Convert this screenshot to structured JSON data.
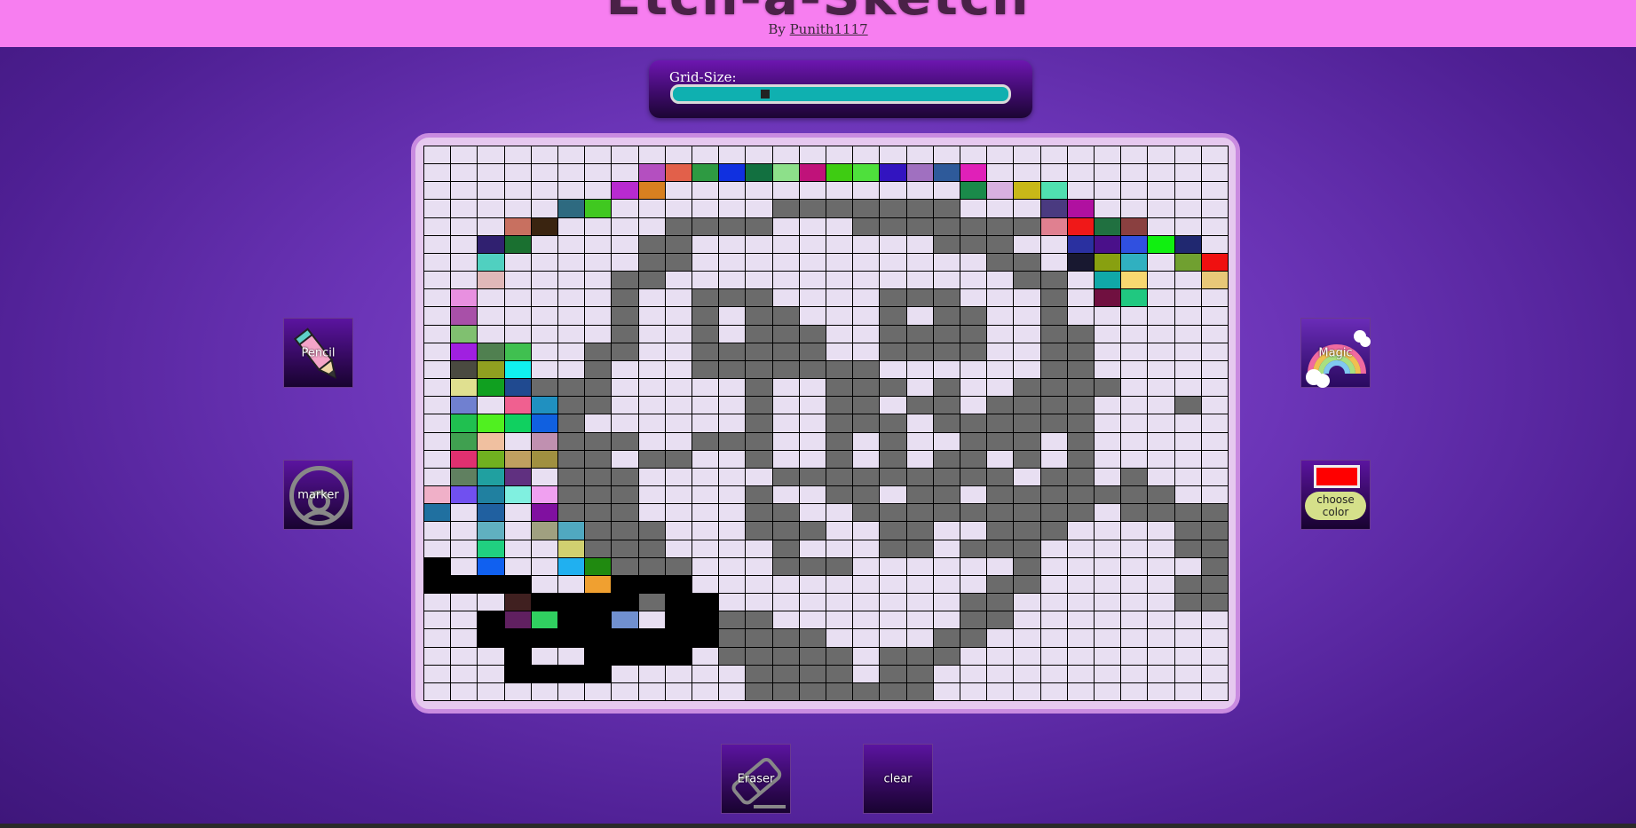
{
  "header": {
    "title": "Etch-a-Sketch",
    "byline_prefix": "By",
    "author": "Punith1117"
  },
  "grid_size": {
    "label": "Grid-Size:",
    "value_fraction": 0.27
  },
  "tools": {
    "pencil": "Pencil",
    "marker": "marker",
    "magic": "Magic",
    "choose_color": "choose color",
    "eraser": "Eraser",
    "clear": "clear"
  },
  "colors": {
    "selected_color": "#ff0000",
    "header_bg": "#f77ef0",
    "cell_empty": "#e8dff2",
    "marker_gray": "#6b6b6b",
    "black": "#000000"
  },
  "grid": {
    "columns": 30,
    "rows": 31,
    "empty": "#e8dff2",
    "palette": {
      "E": "#e8dff2",
      "G": "#6b6b6b",
      "K": "#000000",
      "a": "#b44fc0",
      "b": "#e2604a",
      "c": "#2e9a42",
      "d": "#1030e0",
      "e": "#127040",
      "f": "#8de08a",
      "g": "#c0127a",
      "h": "#3ecc12",
      "i": "#4ee03c",
      "j": "#3214c0",
      "k": "#a070c0",
      "l": "#2e5a9a",
      "m": "#e020b8",
      "n": "#b82ad0",
      "o": "#d88020",
      "p": "#1a8a4a",
      "q": "#d8b0e0",
      "r": "#c8b818",
      "s": "#50e0b0",
      "t": "#2e6a80",
      "u": "#40c820",
      "v": "#4a3a80",
      "w": "#b010a0",
      "x": "#c87060",
      "y": "#3a2410",
      "z": "#e08090",
      "A": "#f01818",
      "B": "#207040",
      "C": "#8a4040",
      "D": "#302070",
      "F": "#1a7030",
      "H": "#2a30a0",
      "I": "#4a108a",
      "J": "#3050e0",
      "L": "#10f010",
      "M": "#202870",
      "N": "#50d0c0",
      "O": "#181830",
      "P": "#88a010",
      "Q": "#30b0c0",
      "R": "#70a030",
      "S": "#f01010",
      "T": "#e0b8b8",
      "U": "#10a8a8",
      "V": "#f8d870",
      "W": "#e8c878",
      "X": "#e890e0",
      "Y": "#701040",
      "Z": "#20c880",
      "0": "#a850a8",
      "1": "#80c070",
      "2": "#a020e0",
      "3": "#508050",
      "4": "#40c050",
      "5": "#4a4a40",
      "6": "#90a020",
      "7": "#10f0f0",
      "8": "#a0a0a0",
      "9": "#e0e090",
      "!": "#10a020",
      "@": "#204a90",
      "#": "#7080d0",
      "$": "#f06090",
      "%": "#2090c0",
      "^": "#20c050",
      "&": "#50f020",
      "*": "#10d060",
      "(": "#1060e0",
      ")": "#40a050",
      "[": "#f0c0a0",
      "]": "#c090b0",
      "{": "#e03070",
      "}": "#70b020",
      ";": "#c0a060",
      ":": "#a09040",
      "<": "#608060",
      ">": "#7050f0",
      "?": "#20a0a0",
      "~": "#603080",
      "+": "#f0b0c8",
      "=": "#2070a0",
      "|": "#2080a0",
      "`": "#80f0e0",
      "'": "#f0a0f0",
      "_": "#8010a0",
      "-": "#2060a0",
      ".": "#60b0c0",
      ",": "#a0a080",
      "/": "#50a8c0",
      "\\": "#20d080",
      "^^": "#d0d070",
      "1b": "#1060f0",
      "2b": "#20b0f0",
      "3b": "#208a10",
      "4b": "#f0a030",
      "5b": "#402020",
      "6b": "#602060",
      "7b": "#30d060",
      "8b": "#7090d0"
    }
  }
}
